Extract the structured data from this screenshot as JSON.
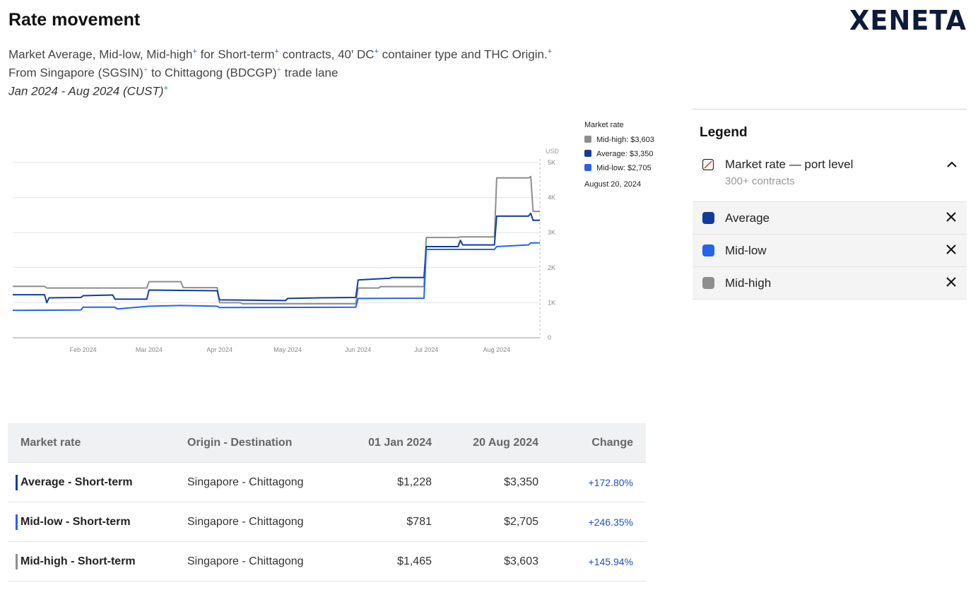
{
  "header": {
    "title": "Rate movement",
    "brand": "XENETA",
    "line1": {
      "t1": "Market Average, Mid-low, Mid-high",
      "t2": " for Short-term",
      "t3": " contracts, 40' DC",
      "t4": " container type and THC Origin.",
      "plus": "+"
    },
    "line2": {
      "t1": "From Singapore (SGSIN)",
      "t2": " to Chittagong (BDCGP)",
      "t3": " trade lane",
      "plus": "+"
    },
    "line3": {
      "t1": "Jan 2024 - Aug 2024 (CUST)",
      "plus": "+"
    }
  },
  "chart_data": {
    "type": "line",
    "unit": "USD",
    "ylim": [
      0,
      5000
    ],
    "yticks": [
      0,
      1000,
      2000,
      3000,
      4000,
      5000
    ],
    "ytick_labels": [
      "0",
      "1K",
      "2K",
      "3K",
      "4K",
      "5K"
    ],
    "xlim": [
      "2024-01-01",
      "2024-08-20"
    ],
    "xticks": [
      "2024-02-01",
      "2024-03-01",
      "2024-04-01",
      "2024-05-01",
      "2024-06-01",
      "2024-07-01",
      "2024-08-01"
    ],
    "xtick_labels": [
      "Feb 2024",
      "Mar 2024",
      "Apr 2024",
      "May 2024",
      "Jun 2024",
      "Jul 2024",
      "Aug 2024"
    ],
    "grid": true,
    "legend_position": "top-right",
    "tooltip": {
      "title": "Market rate",
      "date": "August 20, 2024",
      "items": [
        {
          "label": "Mid-high: $3,603",
          "color": "#8e8e8e"
        },
        {
          "label": "Average: $3,350",
          "color": "#123c9c"
        },
        {
          "label": "Mid-low: $2,705",
          "color": "#2563eb"
        }
      ]
    },
    "series": [
      {
        "name": "Mid-high",
        "color": "#8e8e8e",
        "points": [
          [
            "2024-01-01",
            1465
          ],
          [
            "2024-01-15",
            1465
          ],
          [
            "2024-01-16",
            1420
          ],
          [
            "2024-02-29",
            1420
          ],
          [
            "2024-03-01",
            1600
          ],
          [
            "2024-03-15",
            1600
          ],
          [
            "2024-03-16",
            1430
          ],
          [
            "2024-03-31",
            1430
          ],
          [
            "2024-04-01",
            1000
          ],
          [
            "2024-04-10",
            1000
          ],
          [
            "2024-04-11",
            970
          ],
          [
            "2024-05-31",
            970
          ],
          [
            "2024-06-01",
            1420
          ],
          [
            "2024-06-10",
            1420
          ],
          [
            "2024-06-11",
            1460
          ],
          [
            "2024-06-30",
            1460
          ],
          [
            "2024-07-01",
            2860
          ],
          [
            "2024-07-15",
            2860
          ],
          [
            "2024-07-16",
            2880
          ],
          [
            "2024-07-31",
            2880
          ],
          [
            "2024-08-01",
            4560
          ],
          [
            "2024-08-15",
            4560
          ],
          [
            "2024-08-16",
            4600
          ],
          [
            "2024-08-17",
            3603
          ],
          [
            "2024-08-20",
            3603
          ]
        ]
      },
      {
        "name": "Average",
        "color": "#123c9c",
        "points": [
          [
            "2024-01-01",
            1228
          ],
          [
            "2024-01-15",
            1228
          ],
          [
            "2024-01-16",
            1000
          ],
          [
            "2024-01-17",
            1140
          ],
          [
            "2024-01-31",
            1150
          ],
          [
            "2024-02-01",
            1200
          ],
          [
            "2024-02-14",
            1220
          ],
          [
            "2024-02-15",
            1100
          ],
          [
            "2024-02-29",
            1100
          ],
          [
            "2024-03-01",
            1360
          ],
          [
            "2024-03-31",
            1340
          ],
          [
            "2024-04-01",
            1080
          ],
          [
            "2024-04-30",
            1060
          ],
          [
            "2024-05-01",
            1120
          ],
          [
            "2024-05-15",
            1140
          ],
          [
            "2024-05-31",
            1150
          ],
          [
            "2024-06-01",
            1650
          ],
          [
            "2024-06-15",
            1700
          ],
          [
            "2024-06-16",
            1720
          ],
          [
            "2024-06-30",
            1720
          ],
          [
            "2024-07-01",
            2600
          ],
          [
            "2024-07-15",
            2600
          ],
          [
            "2024-07-16",
            2780
          ],
          [
            "2024-07-17",
            2650
          ],
          [
            "2024-07-31",
            2650
          ],
          [
            "2024-08-01",
            3470
          ],
          [
            "2024-08-15",
            3470
          ],
          [
            "2024-08-16",
            3550
          ],
          [
            "2024-08-17",
            3350
          ],
          [
            "2024-08-20",
            3350
          ]
        ]
      },
      {
        "name": "Mid-low",
        "color": "#2563eb",
        "points": [
          [
            "2024-01-01",
            781
          ],
          [
            "2024-01-31",
            790
          ],
          [
            "2024-02-01",
            870
          ],
          [
            "2024-02-15",
            870
          ],
          [
            "2024-02-16",
            820
          ],
          [
            "2024-03-01",
            900
          ],
          [
            "2024-03-15",
            920
          ],
          [
            "2024-03-31",
            900
          ],
          [
            "2024-04-01",
            860
          ],
          [
            "2024-05-31",
            870
          ],
          [
            "2024-06-01",
            1120
          ],
          [
            "2024-06-30",
            1130
          ],
          [
            "2024-07-01",
            2520
          ],
          [
            "2024-07-31",
            2520
          ],
          [
            "2024-08-01",
            2600
          ],
          [
            "2024-08-15",
            2650
          ],
          [
            "2024-08-16",
            2705
          ],
          [
            "2024-08-20",
            2705
          ]
        ]
      }
    ]
  },
  "legend": {
    "title": "Legend",
    "group": {
      "name": "Market rate — port level",
      "sub": "300+ contracts"
    },
    "items": [
      {
        "label": "Average",
        "color": "#123c9c"
      },
      {
        "label": "Mid-low",
        "color": "#2563eb"
      },
      {
        "label": "Mid-high",
        "color": "#8e8e8e"
      }
    ]
  },
  "table": {
    "headers": [
      "Market rate",
      "Origin - Destination",
      "01 Jan 2024",
      "20 Aug 2024",
      "Change"
    ],
    "rows": [
      {
        "rate": "Average - Short-term",
        "od": "Singapore - Chittagong",
        "start": "$1,228",
        "end": "$3,350",
        "change": "+172.80%",
        "color": "#123c9c"
      },
      {
        "rate": "Mid-low - Short-term",
        "od": "Singapore - Chittagong",
        "start": "$781",
        "end": "$2,705",
        "change": "+246.35%",
        "color": "#2563eb"
      },
      {
        "rate": "Mid-high - Short-term",
        "od": "Singapore - Chittagong",
        "start": "$1,465",
        "end": "$3,603",
        "change": "+145.94%",
        "color": "#8e8e8e"
      }
    ]
  }
}
